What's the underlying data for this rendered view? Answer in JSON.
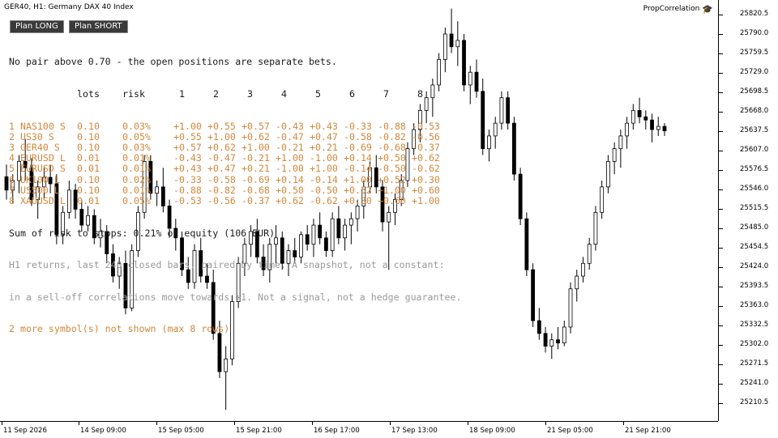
{
  "window": {
    "title": "GER40, H1:  Germany DAX 40 Index",
    "brand": "PropCorrelation",
    "brand_icon": "graduation-cap-icon"
  },
  "toolbar": {
    "plan_long_label": "Plan LONG",
    "plan_short_label": "Plan SHORT"
  },
  "panel": {
    "headline": "No pair above 0.70 - the open positions are separate bets.",
    "columns": [
      "lots",
      "risk",
      "1",
      "2",
      "3",
      "4",
      "5",
      "6",
      "7",
      "8"
    ],
    "rows": [
      {
        "idx": "1",
        "symbol": "NAS100 S",
        "lots": "0.10",
        "risk": "0.03%",
        "corr": [
          "+1.00",
          "+0.55",
          "+0.57",
          "-0.43",
          "+0.43",
          "-0.33",
          "-0.88",
          "-0.53"
        ]
      },
      {
        "idx": "2",
        "symbol": "US30 S",
        "lots": "0.10",
        "risk": "0.05%",
        "corr": [
          "+0.55",
          "+1.00",
          "+0.62",
          "-0.47",
          "+0.47",
          "-0.58",
          "-0.82",
          "-0.56"
        ]
      },
      {
        "idx": "3",
        "symbol": "GER40 S",
        "lots": "0.10",
        "risk": "0.03%",
        "corr": [
          "+0.57",
          "+0.62",
          "+1.00",
          "-0.21",
          "+0.21",
          "-0.69",
          "-0.68",
          "-0.37"
        ]
      },
      {
        "idx": "4",
        "symbol": "EURUSD L",
        "lots": "0.01",
        "risk": "0.01%",
        "corr": [
          "-0.43",
          "-0.47",
          "-0.21",
          "+1.00",
          "-1.00",
          "+0.14",
          "+0.50",
          "+0.62"
        ]
      },
      {
        "idx": "5",
        "symbol": "EURUSD S",
        "lots": "0.01",
        "risk": "0.01%",
        "corr": [
          "+0.43",
          "+0.47",
          "+0.21",
          "-1.00",
          "+1.00",
          "-0.14",
          "-0.50",
          "-0.62"
        ]
      },
      {
        "idx": "6",
        "symbol": "UK100 L",
        "lots": "0.10",
        "risk": "0.02%",
        "corr": [
          "-0.33",
          "-0.58",
          "-0.69",
          "+0.14",
          "-0.14",
          "+1.00",
          "+0.52",
          "+0.30"
        ]
      },
      {
        "idx": "7",
        "symbol": "US500 L",
        "lots": "0.10",
        "risk": "0.01%",
        "corr": [
          "-0.88",
          "-0.82",
          "-0.68",
          "+0.50",
          "-0.50",
          "+0.52",
          "+1.00",
          "+0.60"
        ]
      },
      {
        "idx": "8",
        "symbol": "XAUUSD L",
        "lots": "0.01",
        "risk": "0.05%",
        "corr": [
          "-0.53",
          "-0.56",
          "-0.37",
          "+0.62",
          "-0.62",
          "+0.30",
          "+0.60",
          "+1.00"
        ]
      }
    ],
    "sum_line": "Sum of risk to stops: 0.21% of equity (106 EUR)",
    "note1": "H1 returns, last 240 closed bars, paired by time. A snapshot, not a constant:",
    "note2": "in a sell-off correlations move towards +1. Not a signal, not a hedge guarantee.",
    "note3": "2 more symbol(s) not shown (max 8 rows)"
  },
  "colors": {
    "text_dark": "#1a1a1a",
    "row_orange": "#d2883c",
    "note_grey": "#9a9a9a",
    "button_bg": "#3a3a3a",
    "candle": "#000000"
  },
  "price_axis": [
    "25820.5",
    "25790.0",
    "25759.5",
    "25729.0",
    "25698.5",
    "25668.0",
    "25637.5",
    "25607.0",
    "25576.5",
    "25546.0",
    "25515.5",
    "25485.0",
    "25454.5",
    "25424.0",
    "25393.5",
    "25363.0",
    "25332.5",
    "25302.0",
    "25271.5",
    "25241.0",
    "25210.5"
  ],
  "time_axis": [
    "11 Sep 2026",
    "14 Sep 09:00",
    "15 Sep 05:00",
    "15 Sep 21:00",
    "16 Sep 17:00",
    "17 Sep 13:00",
    "18 Sep 09:00",
    "21 Sep 05:00",
    "21 Sep 21:00"
  ],
  "chart_data": {
    "type": "candlestick",
    "symbol": "GER40",
    "timeframe": "H1",
    "series": [
      {
        "o": 25566,
        "h": 25585,
        "l": 25530,
        "c": 25545
      },
      {
        "o": 25545,
        "h": 25570,
        "l": 25525,
        "c": 25560
      },
      {
        "o": 25560,
        "h": 25600,
        "l": 25540,
        "c": 25590
      },
      {
        "o": 25590,
        "h": 25625,
        "l": 25560,
        "c": 25580
      },
      {
        "o": 25580,
        "h": 25595,
        "l": 25520,
        "c": 25530
      },
      {
        "o": 25530,
        "h": 25560,
        "l": 25500,
        "c": 25550
      },
      {
        "o": 25550,
        "h": 25580,
        "l": 25530,
        "c": 25565
      },
      {
        "o": 25565,
        "h": 25585,
        "l": 25540,
        "c": 25555
      },
      {
        "o": 25555,
        "h": 25570,
        "l": 25460,
        "c": 25475
      },
      {
        "o": 25475,
        "h": 25520,
        "l": 25460,
        "c": 25510
      },
      {
        "o": 25510,
        "h": 25560,
        "l": 25500,
        "c": 25545
      },
      {
        "o": 25545,
        "h": 25555,
        "l": 25500,
        "c": 25515
      },
      {
        "o": 25515,
        "h": 25530,
        "l": 25480,
        "c": 25490
      },
      {
        "o": 25490,
        "h": 25520,
        "l": 25480,
        "c": 25505
      },
      {
        "o": 25505,
        "h": 25515,
        "l": 25460,
        "c": 25470
      },
      {
        "o": 25470,
        "h": 25500,
        "l": 25455,
        "c": 25480
      },
      {
        "o": 25480,
        "h": 25490,
        "l": 25430,
        "c": 25445
      },
      {
        "o": 25445,
        "h": 25460,
        "l": 25400,
        "c": 25410
      },
      {
        "o": 25410,
        "h": 25440,
        "l": 25390,
        "c": 25430
      },
      {
        "o": 25430,
        "h": 25450,
        "l": 25350,
        "c": 25360
      },
      {
        "o": 25360,
        "h": 25460,
        "l": 25355,
        "c": 25450
      },
      {
        "o": 25450,
        "h": 25520,
        "l": 25440,
        "c": 25510
      },
      {
        "o": 25510,
        "h": 25600,
        "l": 25500,
        "c": 25590
      },
      {
        "o": 25590,
        "h": 25600,
        "l": 25530,
        "c": 25540
      },
      {
        "o": 25540,
        "h": 25560,
        "l": 25520,
        "c": 25550
      },
      {
        "o": 25550,
        "h": 25580,
        "l": 25510,
        "c": 25520
      },
      {
        "o": 25520,
        "h": 25530,
        "l": 25470,
        "c": 25485
      },
      {
        "o": 25485,
        "h": 25500,
        "l": 25450,
        "c": 25470
      },
      {
        "o": 25470,
        "h": 25480,
        "l": 25410,
        "c": 25420
      },
      {
        "o": 25420,
        "h": 25440,
        "l": 25390,
        "c": 25400
      },
      {
        "o": 25400,
        "h": 25460,
        "l": 25390,
        "c": 25450
      },
      {
        "o": 25450,
        "h": 25470,
        "l": 25400,
        "c": 25410
      },
      {
        "o": 25410,
        "h": 25430,
        "l": 25390,
        "c": 25400
      },
      {
        "o": 25400,
        "h": 25420,
        "l": 25310,
        "c": 25320
      },
      {
        "o": 25320,
        "h": 25340,
        "l": 25250,
        "c": 25260
      },
      {
        "o": 25260,
        "h": 25300,
        "l": 25200,
        "c": 25280
      },
      {
        "o": 25280,
        "h": 25380,
        "l": 25270,
        "c": 25370
      },
      {
        "o": 25370,
        "h": 25440,
        "l": 25360,
        "c": 25430
      },
      {
        "o": 25430,
        "h": 25470,
        "l": 25410,
        "c": 25460
      },
      {
        "o": 25460,
        "h": 25490,
        "l": 25440,
        "c": 25480
      },
      {
        "o": 25480,
        "h": 25500,
        "l": 25430,
        "c": 25440
      },
      {
        "o": 25440,
        "h": 25460,
        "l": 25410,
        "c": 25420
      },
      {
        "o": 25420,
        "h": 25470,
        "l": 25400,
        "c": 25460
      },
      {
        "o": 25460,
        "h": 25490,
        "l": 25430,
        "c": 25470
      },
      {
        "o": 25470,
        "h": 25480,
        "l": 25420,
        "c": 25430
      },
      {
        "o": 25430,
        "h": 25460,
        "l": 25410,
        "c": 25450
      },
      {
        "o": 25450,
        "h": 25470,
        "l": 25430,
        "c": 25440
      },
      {
        "o": 25440,
        "h": 25480,
        "l": 25430,
        "c": 25475
      },
      {
        "o": 25475,
        "h": 25490,
        "l": 25450,
        "c": 25460
      },
      {
        "o": 25460,
        "h": 25500,
        "l": 25440,
        "c": 25490
      },
      {
        "o": 25490,
        "h": 25510,
        "l": 25460,
        "c": 25470
      },
      {
        "o": 25470,
        "h": 25480,
        "l": 25440,
        "c": 25450
      },
      {
        "o": 25450,
        "h": 25510,
        "l": 25440,
        "c": 25500
      },
      {
        "o": 25500,
        "h": 25520,
        "l": 25460,
        "c": 25470
      },
      {
        "o": 25470,
        "h": 25500,
        "l": 25450,
        "c": 25490
      },
      {
        "o": 25490,
        "h": 25510,
        "l": 25460,
        "c": 25500
      },
      {
        "o": 25500,
        "h": 25530,
        "l": 25480,
        "c": 25520
      },
      {
        "o": 25520,
        "h": 25560,
        "l": 25500,
        "c": 25550
      },
      {
        "o": 25550,
        "h": 25590,
        "l": 25540,
        "c": 25580
      },
      {
        "o": 25580,
        "h": 25600,
        "l": 25540,
        "c": 25550
      },
      {
        "o": 25550,
        "h": 25560,
        "l": 25480,
        "c": 25495
      },
      {
        "o": 25495,
        "h": 25520,
        "l": 25420,
        "c": 25510
      },
      {
        "o": 25510,
        "h": 25540,
        "l": 25490,
        "c": 25530
      },
      {
        "o": 25530,
        "h": 25570,
        "l": 25520,
        "c": 25560
      },
      {
        "o": 25560,
        "h": 25620,
        "l": 25550,
        "c": 25610
      },
      {
        "o": 25610,
        "h": 25650,
        "l": 25600,
        "c": 25640
      },
      {
        "o": 25640,
        "h": 25680,
        "l": 25620,
        "c": 25670
      },
      {
        "o": 25670,
        "h": 25700,
        "l": 25650,
        "c": 25690
      },
      {
        "o": 25690,
        "h": 25720,
        "l": 25660,
        "c": 25710
      },
      {
        "o": 25710,
        "h": 25760,
        "l": 25700,
        "c": 25750
      },
      {
        "o": 25750,
        "h": 25800,
        "l": 25730,
        "c": 25790
      },
      {
        "o": 25790,
        "h": 25830,
        "l": 25760,
        "c": 25770
      },
      {
        "o": 25770,
        "h": 25810,
        "l": 25740,
        "c": 25780
      },
      {
        "o": 25780,
        "h": 25790,
        "l": 25700,
        "c": 25710
      },
      {
        "o": 25710,
        "h": 25740,
        "l": 25680,
        "c": 25730
      },
      {
        "o": 25730,
        "h": 25750,
        "l": 25690,
        "c": 25700
      },
      {
        "o": 25700,
        "h": 25720,
        "l": 25600,
        "c": 25610
      },
      {
        "o": 25610,
        "h": 25640,
        "l": 25590,
        "c": 25630
      },
      {
        "o": 25630,
        "h": 25660,
        "l": 25610,
        "c": 25650
      },
      {
        "o": 25650,
        "h": 25700,
        "l": 25640,
        "c": 25690
      },
      {
        "o": 25690,
        "h": 25700,
        "l": 25640,
        "c": 25650
      },
      {
        "o": 25650,
        "h": 25660,
        "l": 25560,
        "c": 25570
      },
      {
        "o": 25570,
        "h": 25580,
        "l": 25490,
        "c": 25500
      },
      {
        "o": 25500,
        "h": 25510,
        "l": 25410,
        "c": 25420
      },
      {
        "o": 25420,
        "h": 25430,
        "l": 25330,
        "c": 25340
      },
      {
        "o": 25340,
        "h": 25360,
        "l": 25310,
        "c": 25320
      },
      {
        "o": 25320,
        "h": 25330,
        "l": 25290,
        "c": 25300
      },
      {
        "o": 25300,
        "h": 25320,
        "l": 25280,
        "c": 25310
      },
      {
        "o": 25310,
        "h": 25330,
        "l": 25295,
        "c": 25305
      },
      {
        "o": 25305,
        "h": 25340,
        "l": 25300,
        "c": 25330
      },
      {
        "o": 25330,
        "h": 25400,
        "l": 25320,
        "c": 25390
      },
      {
        "o": 25390,
        "h": 25420,
        "l": 25370,
        "c": 25410
      },
      {
        "o": 25410,
        "h": 25440,
        "l": 25400,
        "c": 25430
      },
      {
        "o": 25430,
        "h": 25470,
        "l": 25420,
        "c": 25460
      },
      {
        "o": 25460,
        "h": 25520,
        "l": 25450,
        "c": 25510
      },
      {
        "o": 25510,
        "h": 25560,
        "l": 25500,
        "c": 25550
      },
      {
        "o": 25550,
        "h": 25600,
        "l": 25540,
        "c": 25590
      },
      {
        "o": 25590,
        "h": 25620,
        "l": 25570,
        "c": 25610
      },
      {
        "o": 25610,
        "h": 25640,
        "l": 25580,
        "c": 25630
      },
      {
        "o": 25630,
        "h": 25660,
        "l": 25610,
        "c": 25650
      },
      {
        "o": 25650,
        "h": 25680,
        "l": 25640,
        "c": 25670
      },
      {
        "o": 25670,
        "h": 25690,
        "l": 25650,
        "c": 25660
      },
      {
        "o": 25660,
        "h": 25670,
        "l": 25640,
        "c": 25655
      },
      {
        "o": 25655,
        "h": 25665,
        "l": 25620,
        "c": 25640
      },
      {
        "o": 25640,
        "h": 25660,
        "l": 25630,
        "c": 25645
      },
      {
        "o": 25645,
        "h": 25650,
        "l": 25630,
        "c": 25638
      }
    ],
    "ylim": [
      25195,
      25840
    ],
    "grid": false
  }
}
